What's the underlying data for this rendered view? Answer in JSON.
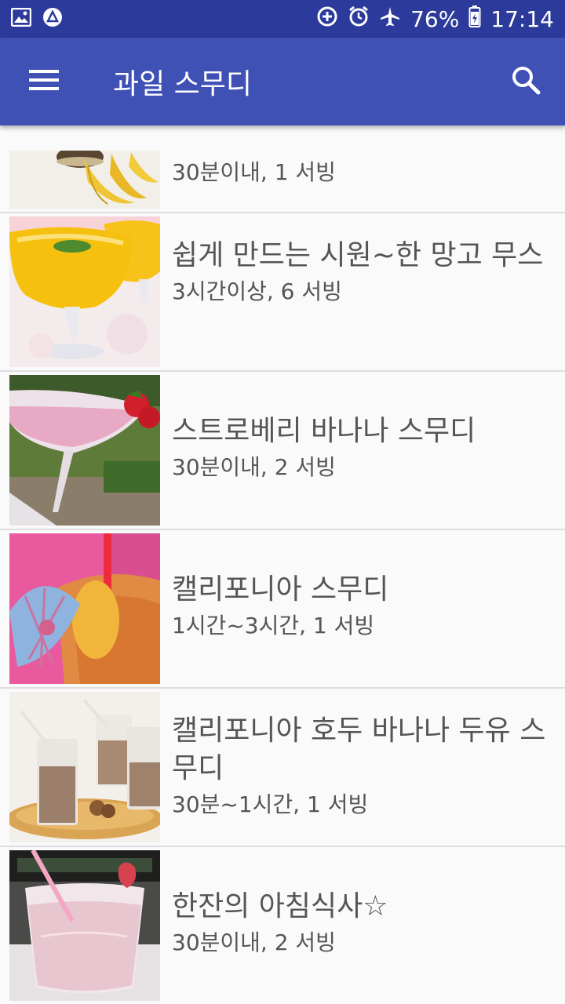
{
  "status": {
    "battery": "76%",
    "time": "17:14"
  },
  "appbar": {
    "title": "과일 스무디"
  },
  "items": [
    {
      "title": "",
      "subtitle": "30분이내, 1 서빙"
    },
    {
      "title": "쉽게 만드는 시원~한 망고 무스",
      "subtitle": "3시간이상, 6 서빙"
    },
    {
      "title": "스트로베리 바나나 스무디",
      "subtitle": "30분이내, 2 서빙"
    },
    {
      "title": "캘리포니아 스무디",
      "subtitle": "1시간~3시간, 1 서빙"
    },
    {
      "title": "캘리포니아 호두 바나나 두유 스무디",
      "subtitle": "30분~1시간, 1 서빙"
    },
    {
      "title": "한잔의 아침식사☆",
      "subtitle": "30분이내, 2 서빙"
    }
  ],
  "icons": [
    "gallery-icon",
    "app-icon",
    "data-saver-icon",
    "alarm-icon",
    "airplane-icon",
    "battery-icon",
    "menu-icon",
    "search-icon"
  ]
}
